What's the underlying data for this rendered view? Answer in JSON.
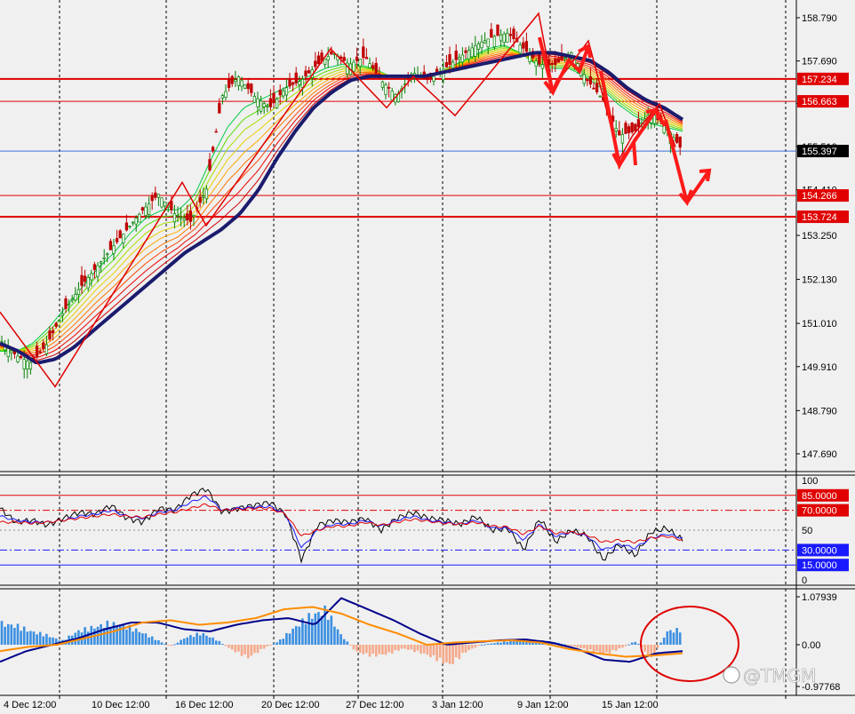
{
  "chart_data": [
    {
      "type": "candlestick",
      "title": "",
      "y_ticks": [
        "158.790",
        "157.690",
        "156.610",
        "155.510",
        "154.410",
        "153.250",
        "152.130",
        "151.010",
        "149.910",
        "148.790",
        "147.690"
      ],
      "ylim": [
        147.28,
        159.29
      ],
      "x_ticks": [
        "4 Dec 12:00",
        "10 Dec 12:00",
        "16 Dec 12:00",
        "20 Dec 12:00",
        "27 Dec 12:00",
        "3 Jan 12:00",
        "9 Jan 12:00",
        "15 Jan 12:00"
      ],
      "current_price": "155.397",
      "levels": [
        {
          "label": "157.234",
          "value": 157.234,
          "color": "#e00000"
        },
        {
          "label": "156.663",
          "value": 156.663,
          "color": "#e00000"
        },
        {
          "label": "154.266",
          "value": 154.266,
          "color": "#e00000"
        },
        {
          "label": "153.724",
          "value": 153.724,
          "color": "#e00000"
        }
      ],
      "close_path": [
        150.6,
        150.2,
        150.0,
        150.5,
        151.3,
        151.9,
        152.4,
        152.9,
        153.4,
        153.9,
        154.3,
        153.8,
        153.6,
        154.4,
        156.8,
        157.3,
        156.8,
        156.5,
        157.0,
        157.2,
        157.6,
        157.9,
        157.6,
        157.8,
        157.2,
        156.8,
        157.4,
        157.2,
        157.5,
        157.8,
        158.1,
        158.3,
        158.4,
        158.0,
        157.6,
        157.6,
        157.9,
        157.2,
        156.7,
        155.8,
        155.9,
        156.4,
        156.0,
        155.4
      ],
      "fast_ma": [
        150.3,
        150.3,
        150.5,
        150.9,
        151.4,
        151.9,
        152.4,
        152.8,
        153.3,
        153.7,
        153.9,
        153.9,
        154.3,
        155.2,
        156.0,
        156.5,
        156.7,
        156.9,
        157.1,
        157.3,
        157.5,
        157.6,
        157.6,
        157.5,
        157.3,
        157.3,
        157.3,
        157.4,
        157.6,
        157.8,
        158.0,
        158.1,
        157.9,
        157.6,
        157.5,
        157.5,
        157.3,
        157.0,
        156.6,
        156.3,
        156.1,
        156.0,
        155.9
      ],
      "slow_ma": [
        150.5,
        150.3,
        150.0,
        150.1,
        150.4,
        150.8,
        151.2,
        151.6,
        152.0,
        152.4,
        152.8,
        153.1,
        153.4,
        153.8,
        154.4,
        155.2,
        155.9,
        156.5,
        156.9,
        157.2,
        157.3,
        157.3,
        157.3,
        157.3,
        157.4,
        157.5,
        157.6,
        157.7,
        157.8,
        157.9,
        157.9,
        157.8,
        157.7,
        157.4,
        157.0,
        156.7,
        156.5,
        156.2
      ],
      "zigzag_points": [
        [
          0,
          151.3
        ],
        [
          62,
          149.4
        ],
        [
          205,
          154.6
        ],
        [
          232,
          153.5
        ],
        [
          372,
          158.0
        ],
        [
          435,
          156.5
        ],
        [
          465,
          157.3
        ],
        [
          512,
          156.3
        ],
        [
          606,
          158.9
        ],
        [
          622,
          157.0
        ],
        [
          662,
          158.2
        ],
        [
          697,
          155.2
        ],
        [
          712,
          155.8
        ],
        [
          742,
          156.6
        ],
        [
          760,
          155.5
        ]
      ]
    },
    {
      "type": "line",
      "ylim": [
        0,
        100
      ],
      "y_ticks": [
        "100",
        "50",
        "0"
      ],
      "levels": [
        {
          "label": "85.0000",
          "value": 85,
          "color": "#e00000"
        },
        {
          "label": "70.0000",
          "value": 70,
          "color": "#e00000"
        },
        {
          "label": "30.0000",
          "value": 30,
          "color": "#1a1aff"
        },
        {
          "label": "15.0000",
          "value": 15,
          "color": "#1a1aff"
        }
      ],
      "series": [
        {
          "color": "#000000",
          "values": [
            72,
            58,
            60,
            55,
            62,
            68,
            66,
            75,
            62,
            58,
            72,
            70,
            85,
            92,
            68,
            72,
            75,
            78,
            66,
            20,
            55,
            60,
            58,
            62,
            50,
            62,
            68,
            62,
            60,
            56,
            64,
            50,
            52,
            30,
            62,
            38,
            50,
            44,
            20,
            36,
            24,
            48,
            52,
            40
          ]
        },
        {
          "color": "#1a1aff",
          "values": [
            64,
            60,
            58,
            58,
            60,
            64,
            66,
            70,
            64,
            62,
            68,
            70,
            78,
            84,
            70,
            72,
            73,
            74,
            66,
            32,
            50,
            56,
            56,
            60,
            54,
            60,
            64,
            60,
            58,
            56,
            60,
            52,
            52,
            40,
            56,
            44,
            48,
            44,
            30,
            36,
            32,
            42,
            46,
            42
          ]
        },
        {
          "color": "#e00000",
          "values": [
            58,
            58,
            57,
            58,
            60,
            62,
            64,
            66,
            64,
            63,
            66,
            68,
            72,
            76,
            70,
            71,
            72,
            72,
            66,
            44,
            50,
            54,
            54,
            58,
            55,
            58,
            61,
            59,
            57,
            56,
            58,
            54,
            53,
            46,
            54,
            47,
            48,
            45,
            38,
            40,
            38,
            42,
            44,
            40
          ]
        }
      ]
    },
    {
      "type": "bar",
      "y_ticks": [
        "1.07939",
        "0.00",
        "-0.97768"
      ],
      "ylim": [
        -0.97768,
        1.07939
      ],
      "histogram": [
        0.55,
        0.5,
        0.35,
        0.25,
        0.1,
        0.35,
        0.45,
        0.55,
        0.5,
        0.35,
        0.15,
        -0.05,
        0.2,
        0.3,
        0.12,
        -0.15,
        -0.35,
        -0.1,
        0.1,
        0.45,
        0.75,
        0.9,
        0.25,
        -0.2,
        -0.3,
        -0.25,
        -0.1,
        -0.2,
        -0.35,
        -0.55,
        -0.2,
        0.0,
        0.05,
        0.1,
        0.12,
        0.1,
        0.05,
        -0.05,
        -0.15,
        -0.25,
        -0.1,
        0.1,
        -0.4,
        0.35,
        0.4
      ],
      "series": [
        {
          "color": "#00008b",
          "values": [
            -0.4,
            -0.15,
            0.0,
            0.15,
            0.35,
            0.5,
            0.5,
            0.35,
            0.3,
            0.45,
            0.55,
            0.6,
            0.45,
            1.05,
            0.8,
            0.55,
            0.25,
            0.0,
            0.05,
            0.1,
            0.12,
            0.05,
            -0.1,
            -0.35,
            -0.4,
            -0.2,
            -0.15
          ]
        },
        {
          "color": "#ff8c00",
          "values": [
            -0.15,
            -0.05,
            0.0,
            0.15,
            0.3,
            0.5,
            0.55,
            0.45,
            0.5,
            0.6,
            0.8,
            0.85,
            0.7,
            0.45,
            0.25,
            0.0,
            0.05,
            0.08,
            0.1,
            0.05,
            -0.1,
            -0.2,
            -0.28,
            -0.25,
            -0.2
          ]
        }
      ]
    }
  ],
  "watermark": "@TMGM"
}
